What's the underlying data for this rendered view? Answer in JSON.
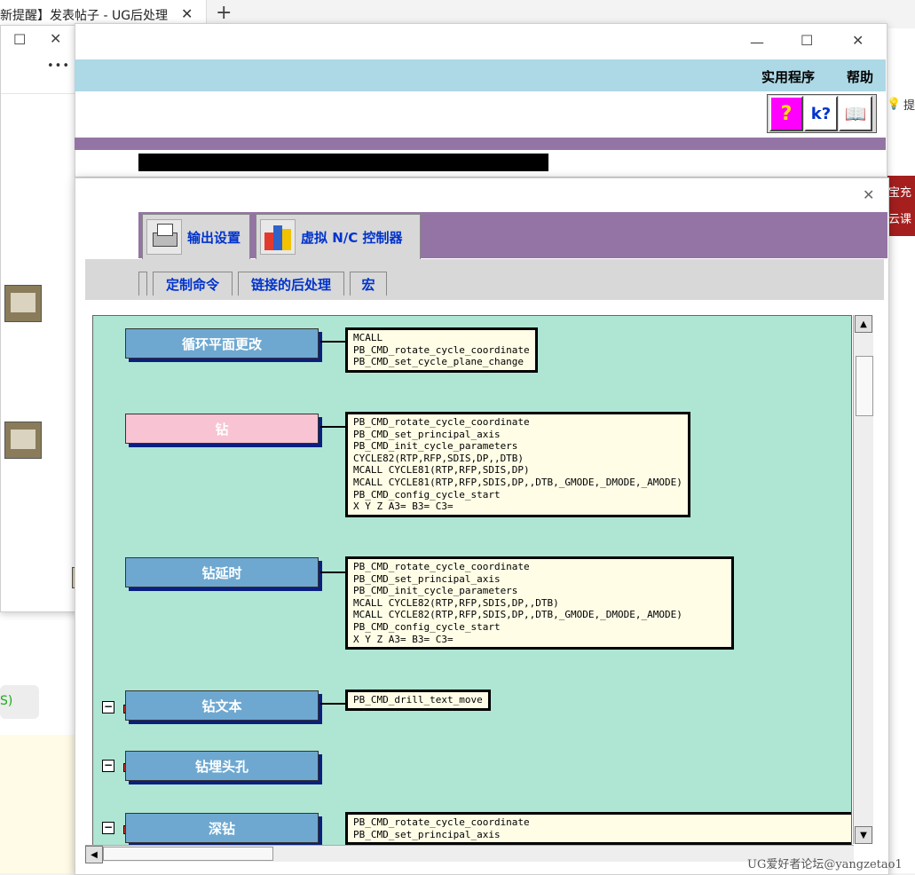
{
  "browser": {
    "tab_title": "新提醒】发表帖子 - UG后处理",
    "tab_close": "✕",
    "new_tab": "+"
  },
  "right_panel": {
    "hint_text": "提",
    "red_lines": [
      "宝充",
      "云课"
    ]
  },
  "chat_window": {
    "more": "•••",
    "minimize": "☐",
    "close": "✕",
    "close2": "✕",
    "status_text": "S)"
  },
  "main_window": {
    "minimize": "—",
    "maximize": "☐",
    "close": "✕",
    "menus": [
      "实用程序",
      "帮助"
    ],
    "toolbar": [
      "?",
      "k?",
      "📖"
    ]
  },
  "dialog": {
    "close": "✕",
    "big_tabs": [
      {
        "label": "输出设置"
      },
      {
        "label": "虚拟 N/C 控制器"
      }
    ],
    "sub_tabs": [
      "定制命令",
      "链接的后处理",
      "宏"
    ],
    "events": [
      {
        "label": "循环平面更改",
        "style": "blue",
        "expander": false,
        "code": [
          "MCALL",
          "PB_CMD_rotate_cycle_coordinate",
          "PB_CMD_set_cycle_plane_change"
        ]
      },
      {
        "label": "钻",
        "style": "pink",
        "expander": false,
        "code": [
          "PB_CMD_rotate_cycle_coordinate",
          "PB_CMD_set_principal_axis",
          "PB_CMD_init_cycle_parameters",
          "CYCLE82(RTP,RFP,SDIS,DP,,DTB)",
          "MCALL CYCLE81(RTP,RFP,SDIS,DP)",
          "MCALL CYCLE81(RTP,RFP,SDIS,DP,,DTB,_GMODE,_DMODE,_AMODE)",
          "PB_CMD_config_cycle_start",
          "X Y Z A3= B3= C3="
        ]
      },
      {
        "label": "钻延时",
        "style": "blue",
        "expander": false,
        "code": [
          "PB_CMD_rotate_cycle_coordinate",
          "PB_CMD_set_principal_axis",
          "PB_CMD_init_cycle_parameters",
          "MCALL CYCLE82(RTP,RFP,SDIS,DP,,DTB)",
          "MCALL CYCLE82(RTP,RFP,SDIS,DP,,DTB,_GMODE,_DMODE,_AMODE)",
          "PB_CMD_config_cycle_start",
          "X Y Z A3= B3= C3="
        ]
      },
      {
        "label": "钻文本",
        "style": "blue",
        "expander": true,
        "code": [
          "PB_CMD_drill_text_move"
        ]
      },
      {
        "label": "钻埋头孔",
        "style": "blue",
        "expander": true,
        "code": []
      },
      {
        "label": "深钻",
        "style": "blue",
        "expander": true,
        "code": [
          "PB_CMD_rotate_cycle_coordinate",
          "PB_CMD_set_principal_axis"
        ]
      }
    ]
  },
  "watermark": "UG爱好者论坛@yangzetao1"
}
